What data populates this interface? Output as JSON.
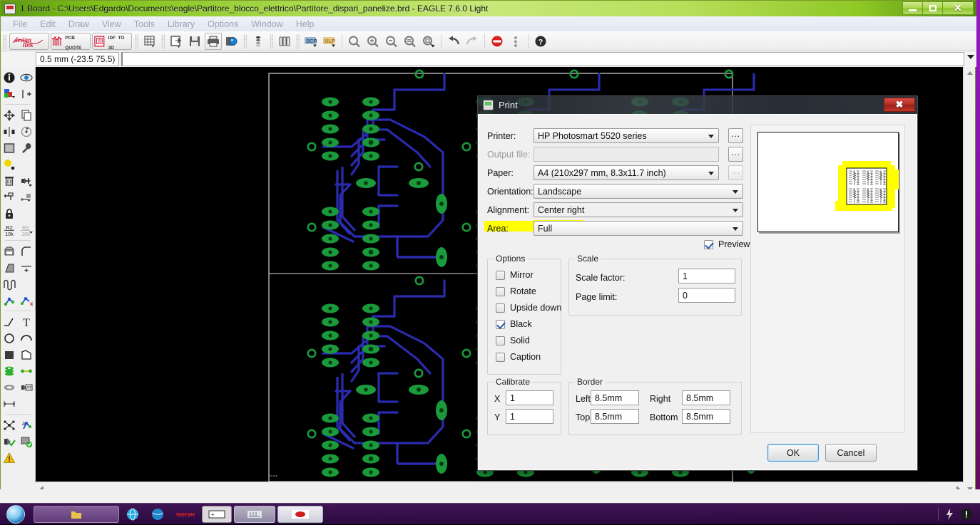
{
  "window": {
    "title": "1 Board - C:\\Users\\Edgardo\\Documents\\eagle\\Partitore_blocco_elettrico\\Partitore_dispari_panelize.brd - EAGLE 7.6.0 Light",
    "minimize_label": "–",
    "maximize_label": "❐",
    "close_label": "✕"
  },
  "menubar": {
    "items": [
      {
        "label": "File"
      },
      {
        "label": "Edit"
      },
      {
        "label": "Draw"
      },
      {
        "label": "View"
      },
      {
        "label": "Tools"
      },
      {
        "label": "Library"
      },
      {
        "label": "Options"
      },
      {
        "label": "Window"
      },
      {
        "label": "Help"
      }
    ]
  },
  "toolbar": {
    "design_link_label": "design",
    "design_link_label2": "link",
    "pcb_quote_line1": "PCB",
    "pcb_quote_line2": "QUOTE",
    "idf_line1": "IDF",
    "idf_line2": "TO 3D",
    "scr_label": "SCR",
    "ulp_label": "ULP"
  },
  "statusline": {
    "coordinates": "0.5 mm (-23.5 75.5)",
    "command_value": ""
  },
  "dialog": {
    "title": "Print",
    "close_label": "✖",
    "fields": {
      "printer_label": "Printer:",
      "printer_value": "HP Photosmart 5520 series",
      "output_file_label": "Output file:",
      "output_file_value": "",
      "paper_label": "Paper:",
      "paper_value": "A4 (210x297 mm, 8.3x11.7 inch)",
      "orientation_label": "Orientation:",
      "orientation_value": "Landscape",
      "alignment_label": "Alignment:",
      "alignment_value": "Center right",
      "area_label": "Area:",
      "area_value": "Full",
      "browse_label": "..."
    },
    "preview_checkbox": {
      "label": "Preview",
      "checked": true
    },
    "options_group": {
      "legend": "Options",
      "items": [
        {
          "label": "Mirror",
          "checked": false
        },
        {
          "label": "Rotate",
          "checked": false
        },
        {
          "label": "Upside down",
          "checked": false
        },
        {
          "label": "Black",
          "checked": true
        },
        {
          "label": "Solid",
          "checked": false
        },
        {
          "label": "Caption",
          "checked": false
        }
      ]
    },
    "scale_group": {
      "legend": "Scale",
      "scale_factor_label": "Scale factor:",
      "scale_factor_value": "1",
      "page_limit_label": "Page limit:",
      "page_limit_value": "0"
    },
    "calibrate_group": {
      "legend": "Calibrate",
      "x_label": "X",
      "x_value": "1",
      "y_label": "Y",
      "y_value": "1"
    },
    "border_group": {
      "legend": "Border",
      "left_label": "Left",
      "left_value": "8.5mm",
      "right_label": "Right",
      "right_value": "8.5mm",
      "top_label": "Top",
      "top_value": "8.5mm",
      "bottom_label": "Bottom",
      "bottom_value": "8.5mm"
    },
    "buttons": {
      "ok_label": "OK",
      "cancel_label": "Cancel"
    }
  },
  "colors": {
    "highlight_yellow": "#ffff00",
    "pad_green": "#1a9a3a",
    "trace_blue": "#2b2bb0",
    "canvas_black": "#000000",
    "title_green": "#8ec825",
    "dialog_close_red": "#b32f24",
    "accent_blue": "#3d93d8"
  }
}
